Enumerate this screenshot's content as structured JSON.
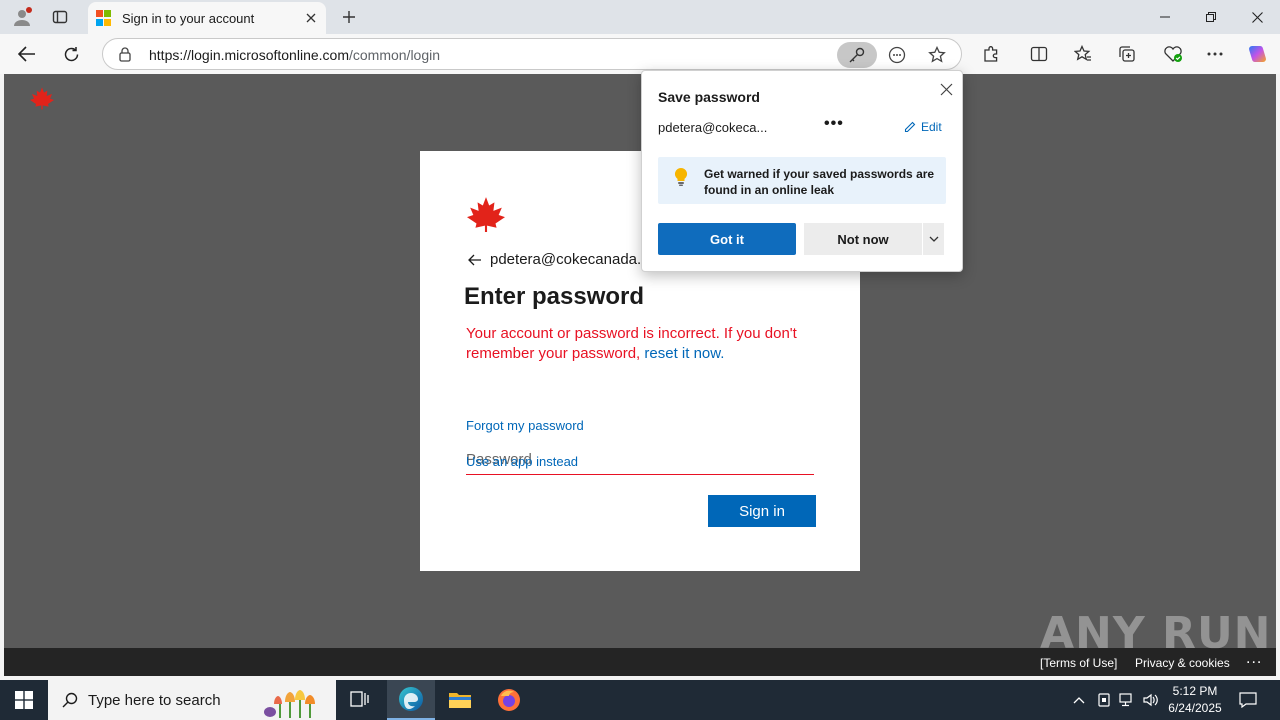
{
  "browser": {
    "tab_title": "Sign in to your account",
    "url_host": "https://login.microsoftonline.com",
    "url_path": "/common/login"
  },
  "page": {
    "identity_email": "pdetera@cokecanada.c",
    "heading": "Enter password",
    "error_text": "Your account or password is incorrect. If you don't remember your password, ",
    "error_link": "reset it now.",
    "password_placeholder": "Password",
    "forgot_link": "Forgot my password",
    "app_link": "Use an app instead",
    "signin_label": "Sign in",
    "footer_terms": "[Terms of Use]",
    "footer_privacy": "Privacy & cookies",
    "footer_more": "...",
    "watermark": "ANY RUN",
    "brand_color": "#e2231a"
  },
  "flyout": {
    "title": "Save password",
    "account": "pdetera@cokeca...",
    "more": "•••",
    "edit_label": "Edit",
    "info_text": "Get warned if your saved passwords are found in an online leak",
    "got_it": "Got it",
    "not_now": "Not now"
  },
  "taskbar": {
    "search_placeholder": "Type here to search",
    "time": "5:12 PM",
    "date": "6/24/2025"
  }
}
